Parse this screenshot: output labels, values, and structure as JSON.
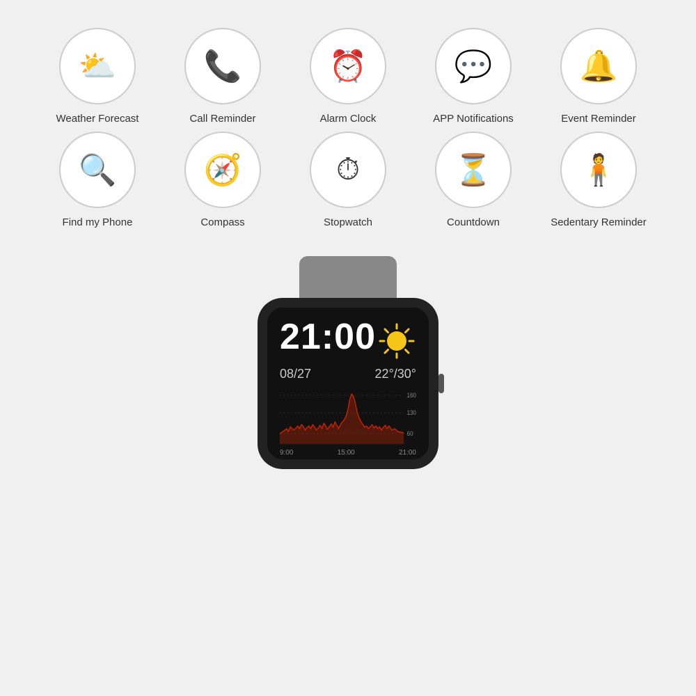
{
  "features": {
    "row1": [
      {
        "id": "weather-forecast",
        "label": "Weather Forecast",
        "icon": "⛅"
      },
      {
        "id": "call-reminder",
        "label": "Call Reminder",
        "icon": "📞"
      },
      {
        "id": "alarm-clock",
        "label": "Alarm Clock",
        "icon": "⏰"
      },
      {
        "id": "app-notifications",
        "label": "APP Notifications",
        "icon": "💬"
      },
      {
        "id": "event-reminder",
        "label": "Event Reminder",
        "icon": "🔔"
      }
    ],
    "row2": [
      {
        "id": "find-my-phone",
        "label": "Find my Phone",
        "icon": "🔍"
      },
      {
        "id": "compass",
        "label": "Compass",
        "icon": "🧭"
      },
      {
        "id": "stopwatch",
        "label": "Stopwatch",
        "icon": "⏱"
      },
      {
        "id": "countdown",
        "label": "Countdown",
        "icon": "⏳"
      },
      {
        "id": "sedentary-reminder",
        "label": "Sedentary Reminder",
        "icon": "🧍"
      }
    ]
  },
  "watch": {
    "time": "21:00",
    "date": "08/27",
    "temp": "22°/30°",
    "chart_labels": [
      "160",
      "130",
      "60"
    ],
    "chart_times": [
      "9:00",
      "15:00",
      "21:00"
    ]
  }
}
